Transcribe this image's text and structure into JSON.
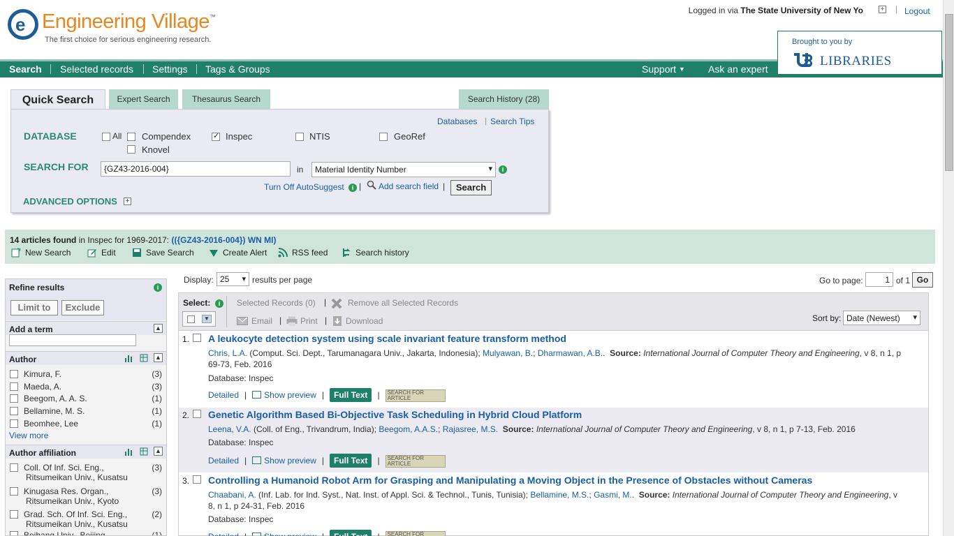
{
  "brand": {
    "name": "Engineering Village",
    "tm": "™",
    "tagline": "The first choice for serious engineering research."
  },
  "login": {
    "prefix": "Logged in via",
    "institution": "The State University of New Yo",
    "logout": "Logout"
  },
  "nav": {
    "search": "Search",
    "selected": "Selected records",
    "settings": "Settings",
    "tags": "Tags & Groups",
    "support": "Support",
    "ask": "Ask an expert"
  },
  "brought": {
    "label": "Brought to you by",
    "libraries": "Libraries"
  },
  "tabs": {
    "quick": "Quick Search",
    "expert": "Expert Search",
    "thesaurus": "Thesaurus Search",
    "history": "Search History (28)"
  },
  "panel": {
    "databases_link": "Databases",
    "tips_link": "Search Tips",
    "database_label": "DATABASE",
    "db": {
      "all": "All",
      "compendex": "Compendex",
      "inspec": "Inspec",
      "ntis": "NTIS",
      "georef": "GeoRef",
      "knovel": "Knovel"
    },
    "search_for_label": "SEARCH FOR",
    "query": "{GZ43-2016-004}",
    "in": "in",
    "field": "Material Identity Number",
    "autosuggest": "Turn Off AutoSuggest",
    "add_field": "Add search field",
    "search_btn": "Search",
    "advanced": "ADVANCED OPTIONS"
  },
  "results_bar": {
    "count": "14 articles found",
    "in_text": " in Inspec for 1969-2017: ",
    "query": "(({GZ43-2016-004}) WN MI)",
    "actions": {
      "new": "New Search",
      "edit": "Edit",
      "save": "Save Search",
      "alert": "Create Alert",
      "rss": "RSS feed",
      "history": "Search history"
    }
  },
  "display": {
    "label": "Display:",
    "value": "25",
    "suffix": "results per page",
    "goto": "Go to page:",
    "page": "1",
    "of": "of 1",
    "go": "Go"
  },
  "toolbar": {
    "select": "Select:",
    "selected": "Selected Records (0)",
    "remove": "Remove all Selected Records",
    "email": "Email",
    "print": "Print",
    "download": "Download",
    "sort_label": "Sort by:",
    "sort_value": "Date (Newest)"
  },
  "refine": {
    "title": "Refine results",
    "limit": "Limit to",
    "exclude": "Exclude",
    "add_term": "Add a term",
    "author_head": "Author",
    "authors": [
      {
        "name": "Kimura, F.",
        "count": "(3)"
      },
      {
        "name": "Maeda, A.",
        "count": "(3)"
      },
      {
        "name": "Beegom, A. A. S.",
        "count": "(1)"
      },
      {
        "name": "Bellamine, M. S.",
        "count": "(1)"
      },
      {
        "name": "Beomhee, Lee",
        "count": "(1)"
      }
    ],
    "view_more": "View more",
    "affil_head": "Author affiliation",
    "affils": [
      {
        "l1": "Coll. Of Inf. Sci. Eng.,",
        "l2": "Ritsumeikan Univ., Kusatsu",
        "count": "(3)"
      },
      {
        "l1": "Kinugasa Res. Organ.,",
        "l2": "Ritsumeikan Univ., Kyoto",
        "count": "(3)"
      },
      {
        "l1": "Grad. Sch. Of Inf. Sci. Eng.,",
        "l2": "Ritsumeikan Univ., Kusatsu",
        "count": "(2)"
      },
      {
        "l1": "Beihang Univ., Beijing",
        "l2": "",
        "count": "(1)"
      }
    ]
  },
  "results": [
    {
      "num": "1.",
      "title": "A leukocyte detection system using scale invariant feature transform method",
      "a1": "Chris, L.A.",
      "a1aff": " (Comput. Sci. Dept., Tarumanagara Univ., Jakarta, Indonesia); ",
      "a2": "Mulyawan, B.",
      "a3": "Dharmawan, A.B.",
      "source_label": "Source:",
      "journal": "International Journal of Computer Theory and Engineering",
      "details": ", v 8, n 1, p 69-73, Feb. 2016",
      "db": "Database: Inspec"
    },
    {
      "num": "2.",
      "title": "Genetic Algorithm Based Bi-Objective Task Scheduling in Hybrid Cloud Platform",
      "a1": "Leena, V.A.",
      "a1aff": " (Coll. of Eng., Trivandrum, India); ",
      "a2": "Beegom, A.A.S.",
      "a3": "Rajasree, M.S.",
      "source_label": "Source:",
      "journal": "International Journal of Computer Theory and Engineering",
      "details": ", v 8, n 1, p 7-13, Feb. 2016",
      "db": "Database: Inspec"
    },
    {
      "num": "3.",
      "title": "Controlling a Humanoid Robot Arm for Grasping and Manipulating a Moving Object in the Presence of Obstacles without Cameras",
      "a1": "Chaabani, A.",
      "a1aff": " (Inf. Lab. for Ind. Syst., Nat. Inst. of Appl. Sci. & Technol., Tunis, Tunisia); ",
      "a2": "Bellamine, M.S.",
      "a3": "Gasmi, M.",
      "source_label": "Source:",
      "journal": "International Journal of Computer Theory and Engineering",
      "details": ", v 8, n 1, p 24-31, Feb. 2016",
      "db": "Database: Inspec"
    }
  ],
  "result_links": {
    "detailed": "Detailed",
    "preview": "Show preview",
    "fulltext": "Full Text",
    "sfa": "SEARCH FOR ARTICLE"
  }
}
